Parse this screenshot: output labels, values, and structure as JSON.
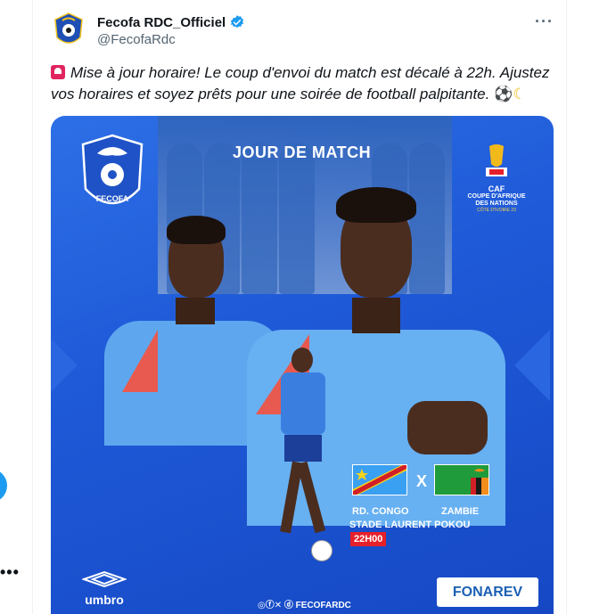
{
  "author": {
    "display_name": "Fecofa RDC_Officiel",
    "handle": "@FecofaRdc",
    "verified": true
  },
  "tweet": {
    "text": "Mise à jour horaire! Le coup d'envoi du match est décalé à 22h. Ajustez vos horaires et soyez prêts pour une soirée de football palpitante.",
    "emojis": [
      "siren",
      "soccer-ball",
      "crescent-moon"
    ]
  },
  "poster": {
    "headline": "JOUR DE MATCH",
    "fecofa_label": "FECOFA",
    "caf_label": "CAF",
    "caf_subtitle": "COUPE D'AFRIQUE DES NATIONS",
    "caf_host": "CÔTE D'IVOIRE 23",
    "team_home": "RD. CONGO",
    "team_away": "ZAMBIE",
    "vs": "X",
    "stadium": "STADE LAURENT POKOU",
    "kickoff": "22H00",
    "sponsor": "umbro",
    "social_handle": "FECOFARDC",
    "partner": "FONAREV"
  },
  "colors": {
    "accent_blue": "#1d9bf0",
    "poster_blue": "#1f5ad8",
    "kickoff_red": "#e6202a"
  }
}
